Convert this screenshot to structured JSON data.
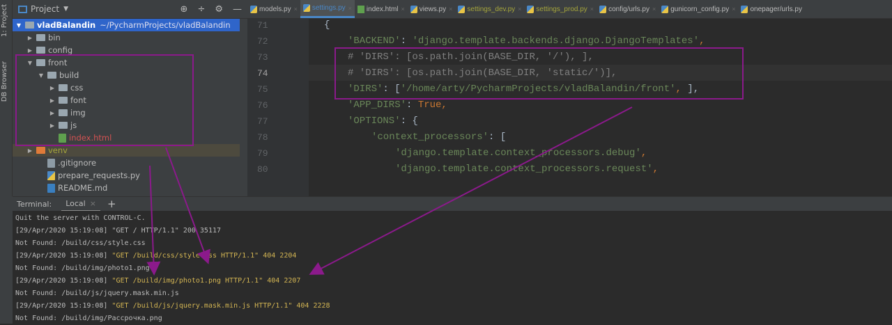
{
  "left_strip": {
    "project_tab": "1: Project",
    "db_tab": "DB Browser"
  },
  "project_panel": {
    "title": "Project",
    "root": {
      "name": "vladBalandin",
      "path": "~/PycharmProjects/vladBalandin"
    },
    "items": [
      {
        "label": "bin",
        "type": "folder",
        "depth": 1,
        "expanded": false
      },
      {
        "label": "config",
        "type": "folder",
        "depth": 1,
        "expanded": false
      },
      {
        "label": "front",
        "type": "folder",
        "depth": 1,
        "expanded": true
      },
      {
        "label": "build",
        "type": "folder",
        "depth": 2,
        "expanded": true
      },
      {
        "label": "css",
        "type": "folder",
        "depth": 3,
        "expanded": false
      },
      {
        "label": "font",
        "type": "folder",
        "depth": 3,
        "expanded": false
      },
      {
        "label": "img",
        "type": "folder",
        "depth": 3,
        "expanded": false
      },
      {
        "label": "js",
        "type": "folder",
        "depth": 3,
        "expanded": false
      },
      {
        "label": "index.html",
        "type": "html",
        "depth": 3
      },
      {
        "label": "venv",
        "type": "venv",
        "depth": 1,
        "expanded": false
      },
      {
        "label": ".gitignore",
        "type": "file",
        "depth": 2
      },
      {
        "label": "prepare_requests.py",
        "type": "py",
        "depth": 2
      },
      {
        "label": "README.md",
        "type": "md",
        "depth": 2
      }
    ]
  },
  "tabs": [
    {
      "label": "models.py",
      "color": "#bbbbbb"
    },
    {
      "label": "settings.py",
      "color": "#4a88c7",
      "active": true
    },
    {
      "label": "index.html",
      "color": "#bbbbbb"
    },
    {
      "label": "views.py",
      "color": "#bbbbbb"
    },
    {
      "label": "settings_dev.py",
      "color": "#a5a53c"
    },
    {
      "label": "settings_prod.py",
      "color": "#a5a53c"
    },
    {
      "label": "config/urls.py",
      "color": "#bbbbbb"
    },
    {
      "label": "gunicorn_config.py",
      "color": "#bbbbbb"
    },
    {
      "label": "onepager/urls.py",
      "color": "#bbbbbb"
    }
  ],
  "editor": {
    "current_line": "74",
    "lines": [
      {
        "n": "71",
        "indent": 0,
        "parts": [
          [
            "p",
            "{"
          ]
        ]
      },
      {
        "n": "72",
        "indent": 1,
        "parts": [
          [
            "s",
            "'BACKEND'"
          ],
          [
            "p",
            ": "
          ],
          [
            "s",
            "'django.template.backends.django.DjangoTemplates'"
          ],
          [
            "k",
            ","
          ]
        ]
      },
      {
        "n": "73",
        "indent": 1,
        "parts": [
          [
            "c",
            "# 'DIRS': [os.path.join(BASE_DIR, '/'), ],"
          ]
        ]
      },
      {
        "n": "74",
        "indent": 1,
        "parts": [
          [
            "c",
            "# 'DIRS': [os.path.join(BASE_DIR, 'static/')],"
          ]
        ]
      },
      {
        "n": "75",
        "indent": 1,
        "parts": [
          [
            "s",
            "'DIRS'"
          ],
          [
            "p",
            ": ["
          ],
          [
            "s",
            "'/home/arty/PycharmProjects/vladBalandin/front'"
          ],
          [
            "k",
            ", "
          ],
          [
            "p",
            "],"
          ]
        ]
      },
      {
        "n": "76",
        "indent": 1,
        "parts": [
          [
            "s",
            "'APP_DIRS'"
          ],
          [
            "p",
            ": "
          ],
          [
            "k",
            "True,"
          ]
        ]
      },
      {
        "n": "77",
        "indent": 1,
        "parts": [
          [
            "s",
            "'OPTIONS'"
          ],
          [
            "p",
            ": {"
          ]
        ]
      },
      {
        "n": "78",
        "indent": 2,
        "parts": [
          [
            "s",
            "'context_processors'"
          ],
          [
            "p",
            ": ["
          ]
        ]
      },
      {
        "n": "79",
        "indent": 3,
        "parts": [
          [
            "s",
            "'django.template.context_processors.debug'"
          ],
          [
            "k",
            ","
          ]
        ]
      },
      {
        "n": "80",
        "indent": 3,
        "parts": [
          [
            "s",
            "'django.template.context_processors.request'"
          ],
          [
            "k",
            ","
          ]
        ]
      }
    ]
  },
  "terminal": {
    "label": "Terminal:",
    "tab": "Local",
    "add": "+",
    "lines": [
      {
        "pre": "Quit the server with CONTROL-C.",
        "hl": ""
      },
      {
        "pre": "[29/Apr/2020 15:19:08] \"GET / HTTP/1.1\" 200 35117",
        "hl": ""
      },
      {
        "pre": "Not Found: /build/css/style.css",
        "hl": ""
      },
      {
        "pre": "[29/Apr/2020 15:19:08] ",
        "hl": "\"GET /build/css/style.css HTTP/1.1\" 404 2204"
      },
      {
        "pre": "Not Found: /build/img/photo1.png",
        "hl": ""
      },
      {
        "pre": "[29/Apr/2020 15:19:08] ",
        "hl": "\"GET /build/img/photo1.png HTTP/1.1\" 404 2207"
      },
      {
        "pre": "Not Found: /build/js/jquery.mask.min.js",
        "hl": ""
      },
      {
        "pre": "[29/Apr/2020 15:19:08] ",
        "hl": "\"GET /build/js/jquery.mask.min.js HTTP/1.1\" 404 2228"
      },
      {
        "pre": "Not Found: /build/img/Рассрочка.png",
        "hl": ""
      }
    ]
  },
  "annotation_color": "#8b1a8b"
}
